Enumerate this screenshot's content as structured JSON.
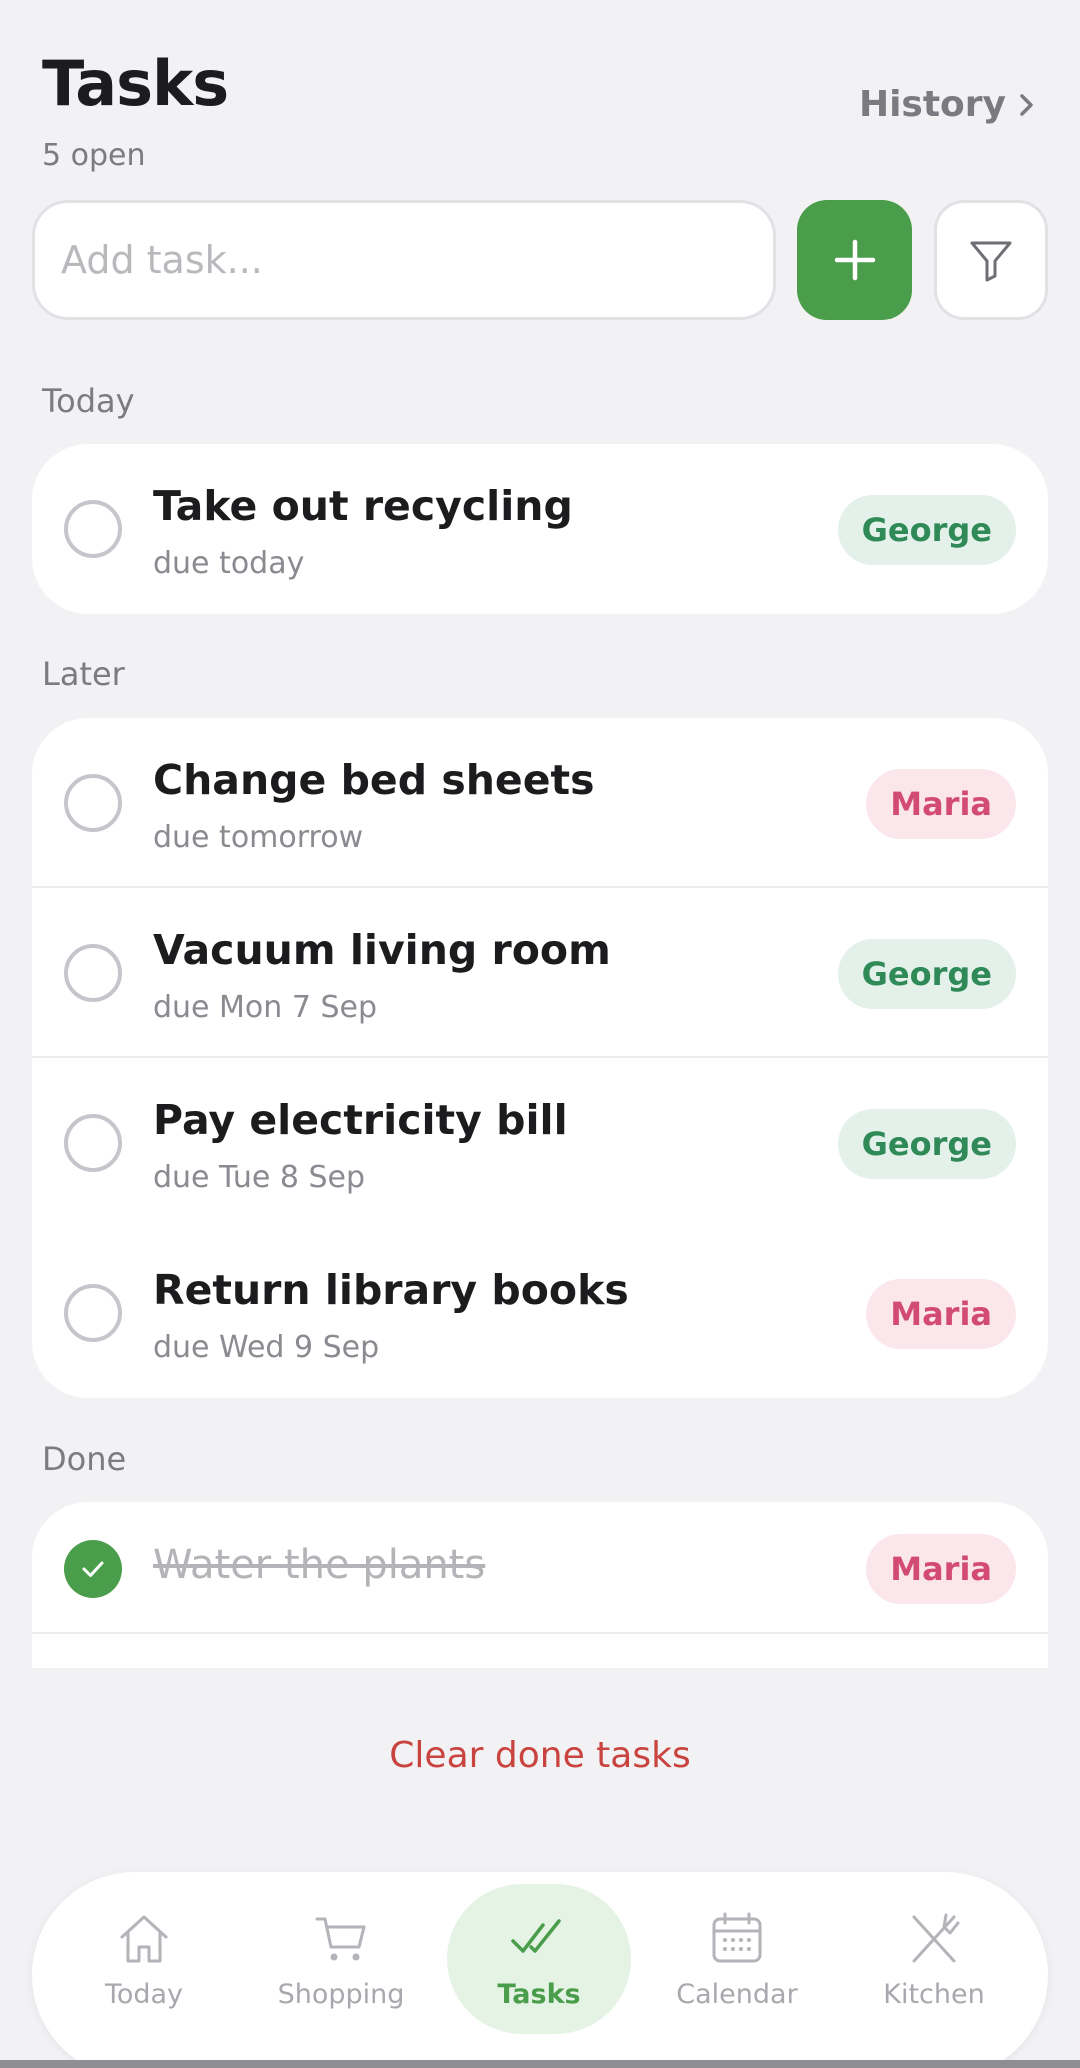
{
  "header": {
    "title": "Tasks",
    "subtitle": "5 open",
    "history_label": "History"
  },
  "add_task": {
    "placeholder": "Add task..."
  },
  "sections": {
    "today": {
      "label": "Today",
      "tasks": [
        {
          "title": "Take out recycling",
          "due": "due today",
          "assignee": "George"
        }
      ]
    },
    "later": {
      "label": "Later",
      "tasks": [
        {
          "title": "Change bed sheets",
          "due": "due tomorrow",
          "assignee": "Maria"
        },
        {
          "title": "Vacuum living room",
          "due": "due Mon 7 Sep",
          "assignee": "George"
        },
        {
          "title": "Pay electricity bill",
          "due": "due Tue 8 Sep",
          "assignee": "George"
        },
        {
          "title": "Return library books",
          "due": "due Wed 9 Sep",
          "assignee": "Maria"
        }
      ]
    },
    "done": {
      "label": "Done",
      "tasks": [
        {
          "title": "Water the plants",
          "assignee": "Maria"
        }
      ]
    }
  },
  "clear_done_label": "Clear done tasks",
  "tabbar": {
    "tabs": [
      {
        "label": "Today",
        "icon": "home-icon"
      },
      {
        "label": "Shopping",
        "icon": "cart-icon"
      },
      {
        "label": "Tasks",
        "icon": "double-check-icon",
        "active": true
      },
      {
        "label": "Calendar",
        "icon": "calendar-icon"
      },
      {
        "label": "Kitchen",
        "icon": "fork-knife-icon"
      }
    ]
  },
  "colors": {
    "accent": "#4a9d4a",
    "george_badge_bg": "#e3f1ea",
    "george_badge_text": "#2f8a57",
    "maria_badge_bg": "#fbe6ec",
    "maria_badge_text": "#d24b76",
    "danger": "#c9433f",
    "background": "#f2f2f5"
  }
}
